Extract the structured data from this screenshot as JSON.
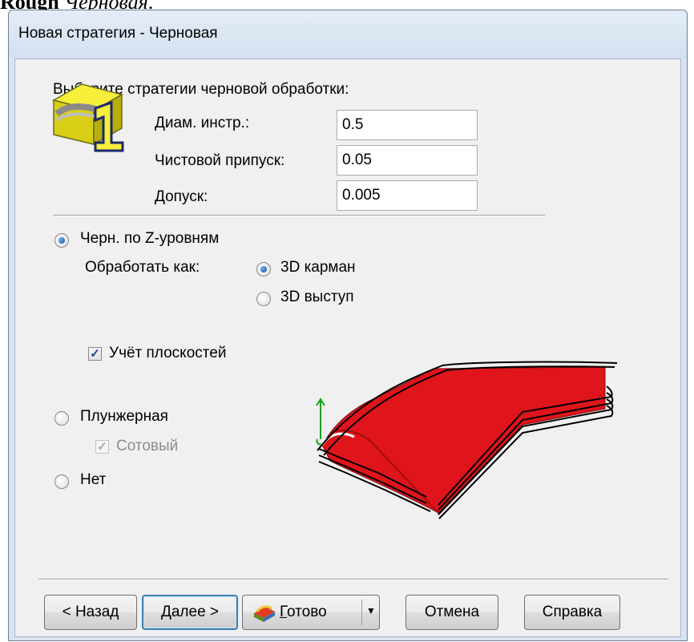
{
  "doc_heading": {
    "bold": "Rough",
    "italic": "Черновая",
    "trail": "."
  },
  "window": {
    "title": "Новая стратегия - Черновая"
  },
  "prompt": "Выберите стратегии черновой обработки:",
  "params": {
    "tool_diam": {
      "label": "Диам. инстр.:",
      "value": "0.5"
    },
    "finish_allowance": {
      "label": "Чистовой припуск:",
      "value": "0.05"
    },
    "tolerance": {
      "label": "Допуск:",
      "value": "0.005"
    }
  },
  "z_level": {
    "label": "Черн. по Z-уровням",
    "selected": true
  },
  "machine_as": {
    "label": "Обработать как:",
    "pocket": {
      "label": "3D карман",
      "selected": true
    },
    "boss": {
      "label": "3D выступ",
      "selected": false
    }
  },
  "flats": {
    "label": "Учёт плоскостей",
    "checked": true
  },
  "plunge": {
    "label": "Плунжерная",
    "selected": false
  },
  "honeycomb": {
    "label": "Сотовый",
    "checked": true,
    "disabled": true
  },
  "none": {
    "label": "Нет",
    "selected": false
  },
  "buttons": {
    "back": "< Назад",
    "next": "Далее >",
    "finish_mnemonic": "Г",
    "finish_rest": "отово",
    "cancel": "Отмена",
    "help": "Справка"
  },
  "colors": {
    "accent": "#3c7fb1",
    "preview_fill": "#e0141b"
  }
}
